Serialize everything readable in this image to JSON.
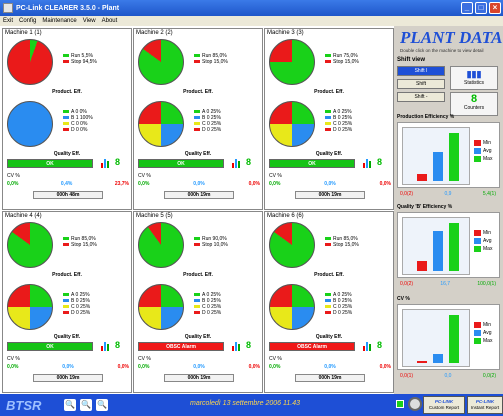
{
  "window": {
    "title": "PC-Link CLEARER 3.5.0 - Plant"
  },
  "menu": [
    "Exit",
    "Config",
    "Maintenance",
    "View",
    "About"
  ],
  "machines": [
    {
      "title": "Machine 1 (1)",
      "run": 5.5,
      "stop": 94.5,
      "run_label": "Run   5,5%",
      "stop_label": "Stop 94,5%",
      "quality": [
        0,
        100,
        0,
        0
      ],
      "quality_labels": [
        "A 0   0%",
        "B 1  100%",
        "C 0   0%",
        "D 0   0%"
      ],
      "status": "OK",
      "status_color": "#16c316",
      "cv": [
        "0,0%",
        "0,4%",
        "23,7%"
      ],
      "time": "000h 48m"
    },
    {
      "title": "Machine 2 (2)",
      "run": 85.0,
      "stop": 15.0,
      "run_label": "Run  85,0%",
      "stop_label": "Stop 15,0%",
      "quality": [
        25,
        25,
        25,
        25
      ],
      "quality_labels": [
        "A 0  25%",
        "B 0  25%",
        "C 0  25%",
        "D 0  25%"
      ],
      "status": "OK",
      "status_color": "#16c316",
      "cv": [
        "0,0%",
        "0,0%",
        "0,0%"
      ],
      "time": "000h 19m"
    },
    {
      "title": "Machine 3 (3)",
      "run": 75.0,
      "stop": 15.0,
      "run_label": "Run  75,0%",
      "stop_label": "Stop 15,0%",
      "quality": [
        25,
        25,
        25,
        25
      ],
      "quality_labels": [
        "A 0  25%",
        "B 0  25%",
        "C 0  25%",
        "D 0  25%"
      ],
      "status": "OK",
      "status_color": "#16c316",
      "cv": [
        "0,0%",
        "0,0%",
        "0,0%"
      ],
      "time": "000h 19m"
    },
    {
      "title": "Machine 4 (4)",
      "run": 85.0,
      "stop": 15.0,
      "run_label": "Run  85,0%",
      "stop_label": "Stop 15,0%",
      "quality": [
        25,
        25,
        25,
        25
      ],
      "quality_labels": [
        "A 0  25%",
        "B 0  25%",
        "C 0  25%",
        "D 0  25%"
      ],
      "status": "OK",
      "status_color": "#16c316",
      "cv": [
        "0,0%",
        "0,0%",
        "0,0%"
      ],
      "time": "000h 19m"
    },
    {
      "title": "Machine 5 (5)",
      "run": 90.0,
      "stop": 10.0,
      "run_label": "Run  90,0%",
      "stop_label": "Stop 10,0%",
      "quality": [
        25,
        25,
        25,
        25
      ],
      "quality_labels": [
        "A 0  25%",
        "B 0  25%",
        "C 0  25%",
        "D 0  25%"
      ],
      "status": "OBSC Alarm",
      "status_color": "#f01818",
      "cv": [
        "0,0%",
        "0,0%",
        "0,0%"
      ],
      "time": "000h 19m"
    },
    {
      "title": "Machine 6 (6)",
      "run": 85.0,
      "stop": 15.0,
      "run_label": "Run  85,0%",
      "stop_label": "Stop 15,0%",
      "quality": [
        25,
        25,
        25,
        25
      ],
      "quality_labels": [
        "A 0  25%",
        "B 0  25%",
        "C 0  25%",
        "D 0  25%"
      ],
      "status": "OBSC Alarm",
      "status_color": "#f01818",
      "cv": [
        "0,0%",
        "0,0%",
        "0,0%"
      ],
      "time": "000h 19m"
    }
  ],
  "labels": {
    "product_eff": "Product. Eff.",
    "quality_eff": "Quality Eff.",
    "cv": "CV %"
  },
  "right": {
    "title": "PLANT DATA",
    "subtitle": "Double click on the machine to view detail",
    "shift_view": "Shift view",
    "shift_buttons": [
      "Shift I",
      "Shift",
      "Shift -"
    ],
    "statistics": "Statistics",
    "counters_value": "8",
    "counters": "Counters",
    "charts": [
      {
        "title": "Production Efficiency %",
        "min": 9,
        "avg": 38,
        "max": 62,
        "vals": [
          "0,0(2)",
          "0,9",
          "5,4(1)"
        ]
      },
      {
        "title": "Quality 'B' Efficiency %",
        "min": 4,
        "avg": 16.7,
        "max": 20,
        "vals": [
          "0,0(2)",
          "16,7",
          "100,0(1)"
        ]
      },
      {
        "title": "CV %",
        "min": 0.1,
        "avg": 4.5,
        "max": 23.7,
        "vals": [
          "0,0(1)",
          "0,0",
          "0,0(2)"
        ]
      }
    ],
    "legend": [
      "Min",
      "Avg",
      "Max"
    ]
  },
  "status_bar": {
    "logo": "BTSR",
    "date": "marcoledì 13 settembre 2006 11.43",
    "custom_report": "Custom Report",
    "instant_report": "Instant Report",
    "pc_link": "PC-LINK"
  },
  "colors": {
    "run": "#19d119",
    "stop": "#ea1a1a",
    "qA": "#19d119",
    "qB": "#2a8cf0",
    "qC": "#e8e81a",
    "qD": "#ea1a1a",
    "min": "#ea1a1a",
    "avg": "#2a8cf0",
    "max": "#19d119"
  }
}
